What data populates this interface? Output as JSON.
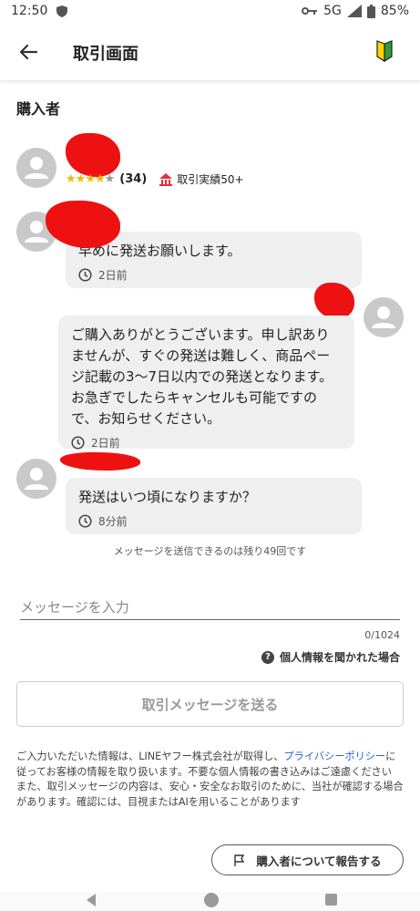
{
  "status_bar": {
    "time": "12:50",
    "network": "5G",
    "battery": "85%"
  },
  "app_bar": {
    "title": "取引画面",
    "back_icon": "arrow-left-icon",
    "badge_icon": "beginner-mark-icon"
  },
  "buyer": {
    "section_title": "購入者",
    "rating_count": "(34)",
    "stars_filled": 4,
    "stars_total": 5,
    "trade_record": "取引実績50+"
  },
  "messages": [
    {
      "sender": "buyer",
      "text": "早めに発送お願いします。",
      "time": "2日前"
    },
    {
      "sender": "seller",
      "text": "ご購入ありがとうございます。申し訳ありませんが、すぐの発送は難しく、商品ページ記載の3〜7日以内での発送となります。お急ぎでしたらキャンセルも可能ですので、お知らせください。",
      "time": "2日前"
    },
    {
      "sender": "buyer",
      "text": "発送はいつ頃になりますか？",
      "time": "8分前"
    }
  ],
  "remaining_notice": "メッセージを送信できるのは残り49回です",
  "input": {
    "placeholder": "メッセージを入力",
    "value": "",
    "counter": "0/1024"
  },
  "privacy_help": "個人情報を聞かれた場合",
  "send_button": "取引メッセージを送る",
  "notice": {
    "part1": "ご入力いただいた情報は、LINEヤフー株式会社が取得し、",
    "link": "プライバシーポリシー",
    "part2": "に従ってお客様の情報を取り扱います。不要な個人情報の書き込みはご遠慮ください",
    "part3": "また、取引メッセージの内容は、安心・安全なお取引のために、当社が確認する場合があります。確認には、目視またはAIを用いることがあります"
  },
  "report_button": "購入者について報告する",
  "colors": {
    "star": "#f5b800",
    "link": "#2266cc",
    "bubble": "#efefef",
    "redaction": "#ee1111",
    "beginner_green": "#2e9b3a",
    "beginner_yellow": "#ffd400"
  }
}
